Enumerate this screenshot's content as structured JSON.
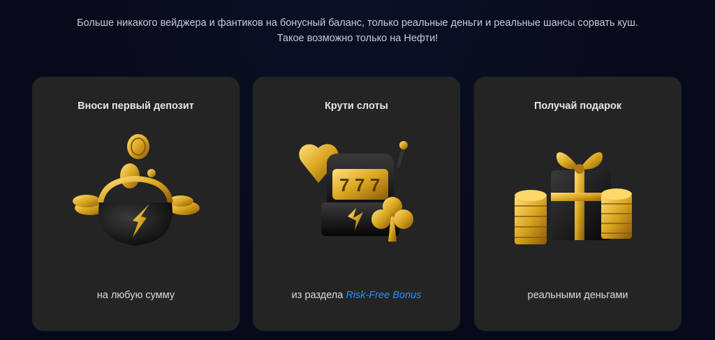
{
  "intro": {
    "line1": "Больше никакого вейджера и фантиков на бонусный баланс, только реальные деньги и реальные шансы сорвать куш.",
    "line2": "Такое возможно только на Нефти!"
  },
  "cards": [
    {
      "title": "Вноси первый депозит",
      "icon": "coin-purse-icon",
      "caption": "на любую сумму"
    },
    {
      "title": "Крути слоты",
      "icon": "slot-machine-icon",
      "caption_prefix": "из раздела ",
      "caption_link": "Risk-Free Bonus"
    },
    {
      "title": "Получай подарок",
      "icon": "gift-box-coins-icon",
      "caption": "реальными деньгами"
    }
  ],
  "colors": {
    "background": "#070a1a",
    "card": "#242424",
    "gold": "#d9a520",
    "link": "#2f8ff2"
  }
}
